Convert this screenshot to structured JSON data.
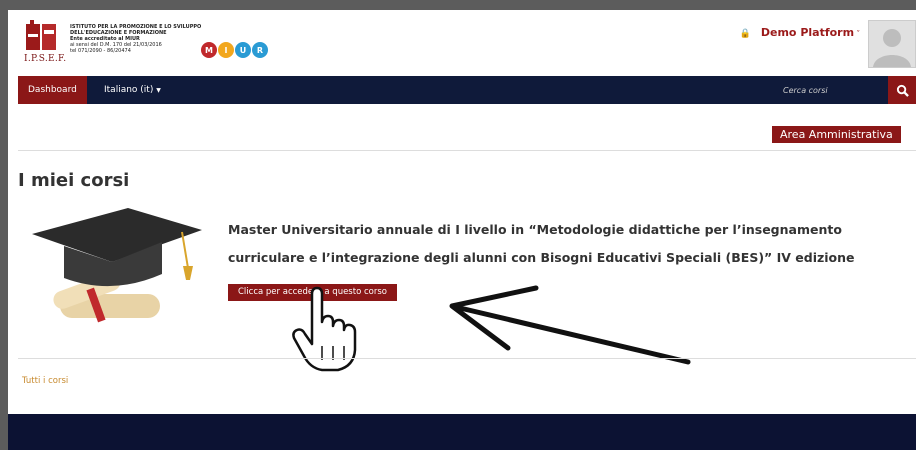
{
  "header": {
    "logo_text": "I.P.S.E.F.",
    "institute_name": "ISTITUTO PER LA PROMOZIONE E LO SVILUPPO DELL'EDUCAZIONE E FORMAZIONE",
    "accreditation": "Ente accreditato al MIUR",
    "decree": "ai sensi del D.M. 170 del 21/03/2016",
    "phone": "tel 071/2090 - 86/20474",
    "miur_letters": [
      "M",
      "I",
      "U",
      "R"
    ],
    "platform_label": "Demo Platform"
  },
  "nav": {
    "dashboard": "Dashboard",
    "language": "Italiano (it)",
    "search_placeholder": "Cerca corsi"
  },
  "admin_button": "Area Amministrativa",
  "page_title": "I miei corsi",
  "course": {
    "title": "Master Universitario annuale di I livello in “Metodologie didattiche per l’insegnamento curriculare e l’integrazione degli alunni con Bisogni Educativi Speciali (BES)” IV edizione",
    "access_button": "Clicca per accedere a questo corso"
  },
  "all_courses_link": "Tutti i corsi",
  "colors": {
    "brand_red": "#8b1717",
    "navbar": "#0f1a3a",
    "footer": "#0c1233",
    "miur": [
      "#c0292c",
      "#f2a71d",
      "#2a9bd4",
      "#2a9bd4"
    ]
  }
}
